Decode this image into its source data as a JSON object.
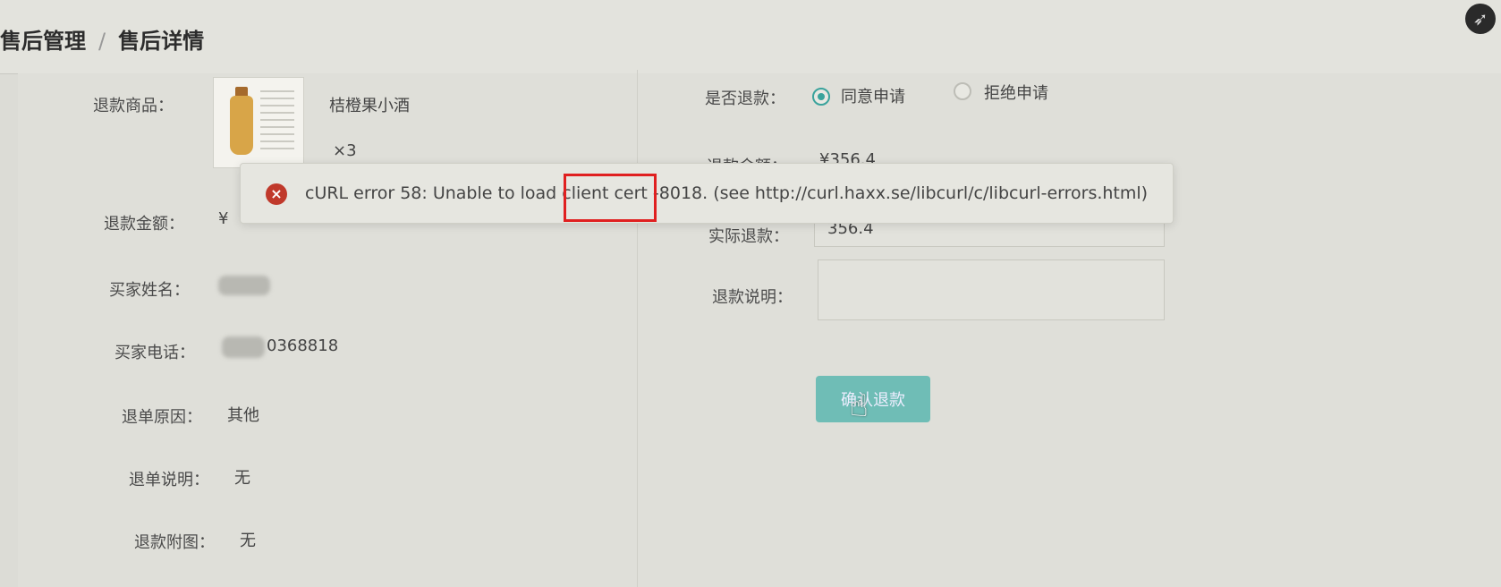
{
  "breadcrumb": {
    "parent": "售后管理",
    "separator": "/",
    "current": "售后详情"
  },
  "left": {
    "product_label": "退款商品：",
    "product_name": "桔橙果小酒",
    "product_qty": "×3",
    "refund_amount_label": "退款金额：",
    "refund_amount_value": "¥",
    "buyer_name_label": "买家姓名：",
    "buyer_phone_label": "买家电话：",
    "buyer_phone_value": "0368818",
    "reason_label": "退单原因：",
    "reason_value": "其他",
    "desc_label": "退单说明：",
    "desc_value": "无",
    "attach_label": "退款附图：",
    "attach_value": "无"
  },
  "right": {
    "refund_q_label": "是否退款：",
    "option_agree": "同意申请",
    "option_reject": "拒绝申请",
    "selected": "agree",
    "amount_label": "退款金额：",
    "amount_value": "¥356.4",
    "actual_label": "实际退款：",
    "actual_value": "356.4",
    "note_label": "退款说明：",
    "note_value": "",
    "confirm_button": "确认退款"
  },
  "toast": {
    "message": "cURL error 58: Unable to load client cert -8018. (see http://curl.haxx.se/libcurl/c/libcurl-errors.html)"
  },
  "colors": {
    "accent": "#3aa39c",
    "button": "#6fbdb6",
    "error": "#c0392b",
    "highlight": "#e02020"
  },
  "icons": {
    "error": "error-circle-icon",
    "compass": "compass-icon",
    "cursor": "hand-pointer-icon"
  }
}
